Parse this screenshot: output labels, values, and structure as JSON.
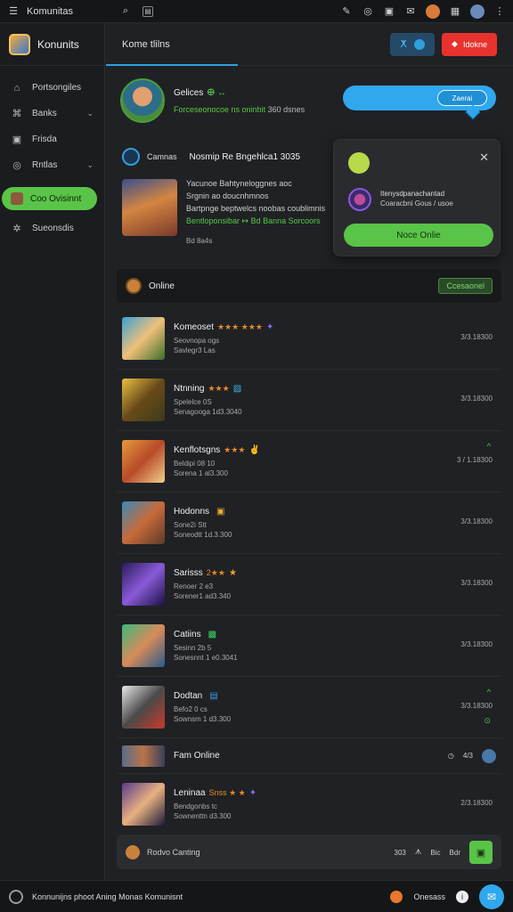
{
  "topbar": {
    "app_name": "Komunitas",
    "icons": [
      "menu-icon",
      "search-icon",
      "bell-icon",
      "settings-icon",
      "chat-icon"
    ]
  },
  "sidebar": {
    "brand": "Konunits",
    "items": [
      {
        "label": "Portsongiles",
        "icon": "home-icon",
        "chevron": false
      },
      {
        "label": "Banks",
        "icon": "bag-icon",
        "chevron": true
      },
      {
        "label": "Frisda",
        "icon": "box-icon",
        "chevron": false
      },
      {
        "label": "Rntlas",
        "icon": "compass-icon",
        "chevron": true
      }
    ],
    "active_item": "Coo Ovisinnt",
    "extra_item": "Sueonsdis"
  },
  "main": {
    "title": "Kome tlilns",
    "red_button_label": "Idokne"
  },
  "profile": {
    "name": "Gelices",
    "name_badge": "ⴲ ↔",
    "status_green": "Forceseonocoe ns oninbit",
    "status_grey": "360 dsnes"
  },
  "chat_bubble": {
    "label": "Zaerai"
  },
  "news": {
    "source": "Camnas",
    "title": "Nosmip Re Bngehlca1 3035",
    "lines": [
      "Yacunoe Bahtyneloggnes aoc",
      "Srgnin ao doucnhmnos",
      "Bartpnge beptwelcs noobas coublimnis",
      "Bentloponsibar ↦ Bd Banna Sorcoors"
    ],
    "meta": "Bd 8a4s"
  },
  "popup": {
    "line1": "Itenysdpanachantad",
    "line2": "Coaracbni Gous / usoe",
    "button": "Noce Onlie"
  },
  "online": {
    "label": "Online",
    "badge": "Ccesaonel"
  },
  "rows": [
    {
      "name": "Komeoset",
      "stars": "★★★ ★★★",
      "badge": "✦",
      "sub": "Seovnopa ogs",
      "sub2": "Savlegr3 Las",
      "time": "3/3.18300",
      "mark": "",
      "mark2": ""
    },
    {
      "name": "Ntnning",
      "stars": "★★★",
      "badge": "▧",
      "sub": "Spelelce 0S",
      "sub2": "Senagooga 1d3.3040",
      "time": "3/3.18300",
      "mark": "",
      "mark2": ""
    },
    {
      "name": "Kenflotsgns",
      "stars": "★★★",
      "badge": "✌",
      "sub": "Beldipi 08 10",
      "sub2": "Sorena 1 al3.300",
      "time": "3 / 1.18300",
      "mark": "^",
      "mark2": ""
    },
    {
      "name": "Hodonns",
      "stars": "",
      "badge": "▣",
      "sub": "Sone2i Stt",
      "sub2": "Soneodtt 1d.3.300",
      "time": "3/3.18300",
      "mark": "",
      "mark2": ""
    },
    {
      "name": "Sarisss",
      "stars": "2★★",
      "badge": "★",
      "sub": "Renoer 2 e3",
      "sub2": "Sorener1 ad3.340",
      "time": "3/3.18300",
      "mark": "",
      "mark2": ""
    },
    {
      "name": "Catiins",
      "stars": "",
      "badge": "▩",
      "sub": "Sesinn 2b 5",
      "sub2": "Sonesnnt 1 e0.3041",
      "time": "3/3.18300",
      "mark": "",
      "mark2": ""
    },
    {
      "name": "Dodtan",
      "stars": "",
      "badge": "▤",
      "sub": "Befo2 0 cs",
      "sub2": "Sownsm 1 d3.300",
      "time": "3/3.18300",
      "mark": "^",
      "mark2": "⊙"
    }
  ],
  "section": {
    "label": "Fam Online",
    "count": "4/3"
  },
  "last_row": {
    "name": "Leninaa",
    "stars": "Snss ★ ★",
    "badge": "✦",
    "sub": "Bendgonbs tc",
    "sub2": "Sownenttn d3.300",
    "time": "2/3.18300"
  },
  "inputbar": {
    "placeholder": "Rodvo Canting",
    "items": [
      "303",
      "ᗑ",
      "Bic",
      "Bdr"
    ]
  },
  "statusbar": {
    "text": "Konnunijns phoot Aning  Monas Komunisnt",
    "right_text": "Onesass"
  },
  "colors": {
    "accent_green": "#59c447",
    "accent_blue": "#2fa8ee",
    "accent_red": "#e8322e"
  }
}
